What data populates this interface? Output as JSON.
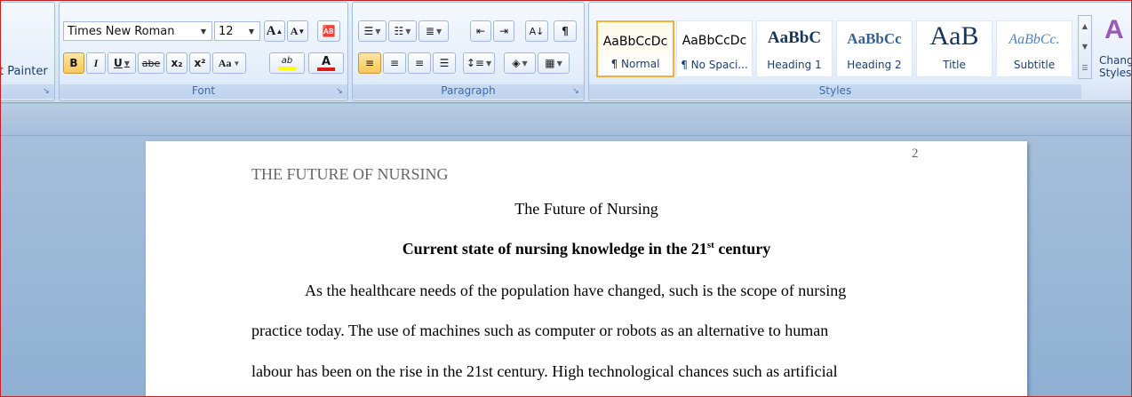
{
  "clipboard": {
    "format_painter_label": "t Painter"
  },
  "font": {
    "group_label": "Font",
    "font_name": "Times New Roman",
    "font_size": "12",
    "grow_label": "A",
    "shrink_label": "A",
    "bold": "B",
    "italic": "I",
    "underline": "U",
    "strike": "abe",
    "subscript": "x₂",
    "superscript": "x²",
    "change_case": "Aa",
    "highlight": "ab",
    "font_color": "A"
  },
  "paragraph": {
    "group_label": "Paragraph",
    "show_marks": "¶"
  },
  "styles": {
    "group_label": "Styles",
    "change_styles_label_1": "Chang",
    "change_styles_label_2": "Styles",
    "items": [
      {
        "sample": "AaBbCcDc",
        "name": "¶ Normal"
      },
      {
        "sample": "AaBbCcDc",
        "name": "¶ No Spaci..."
      },
      {
        "sample": "AaBbC",
        "name": "Heading 1"
      },
      {
        "sample": "AaBbCc",
        "name": "Heading 2"
      },
      {
        "sample": "AaB",
        "name": "Title"
      },
      {
        "sample": "AaBbCc.",
        "name": "Subtitle"
      }
    ]
  },
  "document": {
    "page_number": "2",
    "running_head": "THE FUTURE OF NURSING",
    "title": "The Future of Nursing",
    "heading_main": "Current state of nursing knowledge in the 21",
    "heading_sup": "st",
    "heading_tail": " century",
    "lines": [
      "As the healthcare needs of the population have changed, such is the scope of nursing",
      "practice today. The use of machines such as computer or robots as an alternative to human",
      "labour has been on the rise in the 21st century.  High technological chances such as artificial"
    ]
  },
  "colors": {
    "accent_highlight": "#f2b33b",
    "font_color_bar": "#e01b1b",
    "highlight_bar": "#ffff00"
  }
}
